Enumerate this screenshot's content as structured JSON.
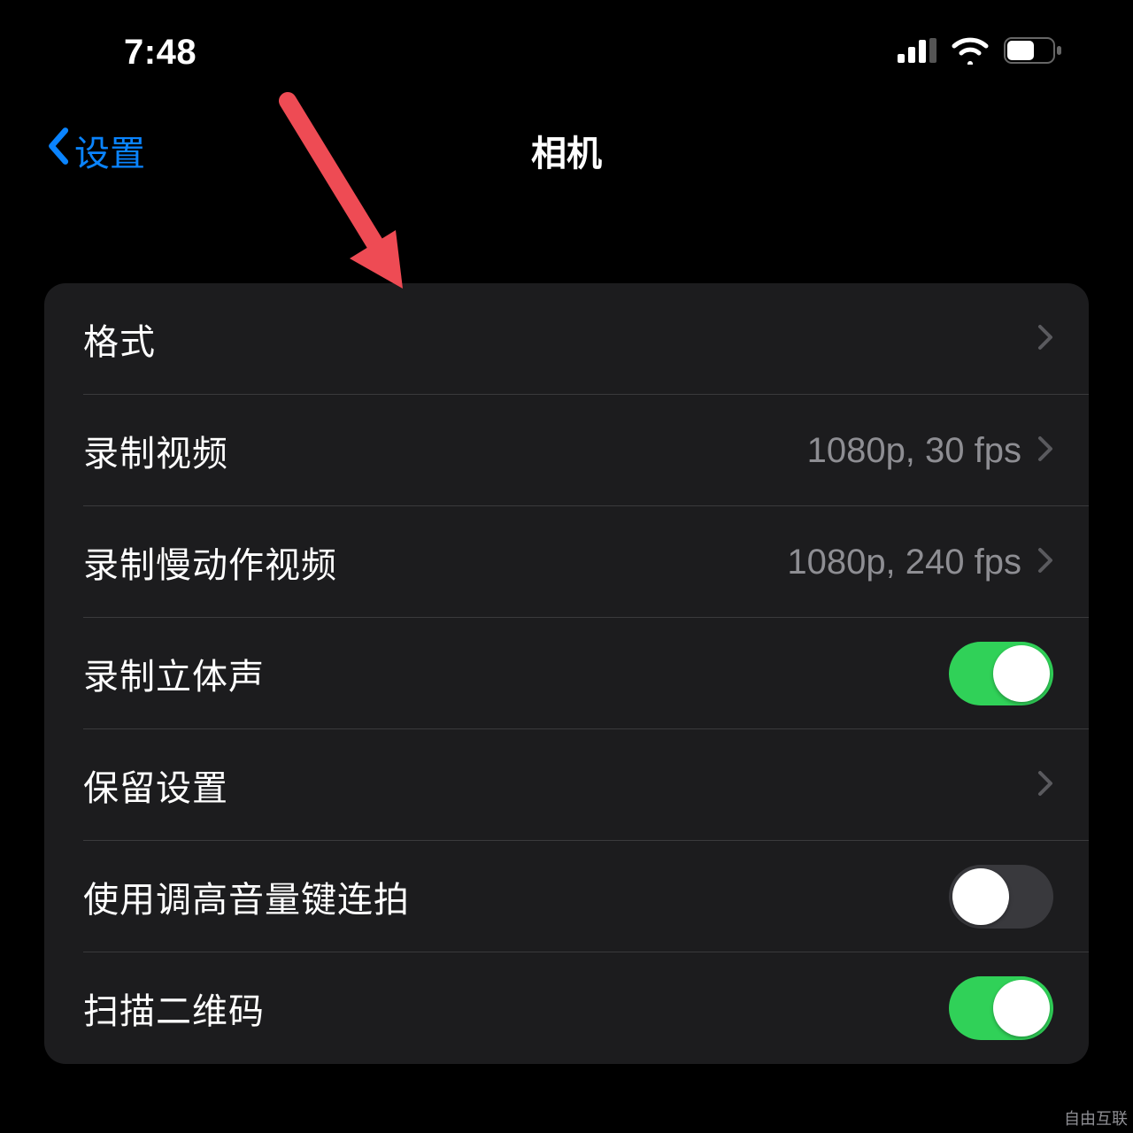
{
  "status": {
    "time": "7:48"
  },
  "nav": {
    "back_label": "设置",
    "title": "相机"
  },
  "rows": {
    "format": {
      "label": "格式"
    },
    "record_video": {
      "label": "录制视频",
      "value": "1080p, 30 fps"
    },
    "record_slowmo": {
      "label": "录制慢动作视频",
      "value": "1080p, 240 fps"
    },
    "stereo": {
      "label": "录制立体声",
      "on": true
    },
    "preserve": {
      "label": "保留设置"
    },
    "volume_burst": {
      "label": "使用调高音量键连拍",
      "on": false
    },
    "scan_qr": {
      "label": "扫描二维码",
      "on": true
    }
  },
  "watermark": "自由互联",
  "colors": {
    "accent": "#0a84ff",
    "toggle_on": "#30d158",
    "card_bg": "#1c1c1e",
    "secondary_text": "#8e8e93",
    "arrow": "#ee4b54"
  }
}
